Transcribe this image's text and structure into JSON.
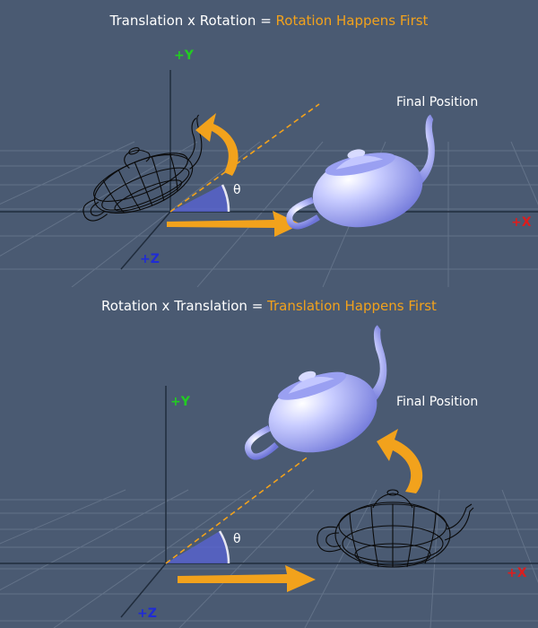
{
  "panels": [
    {
      "title_prefix": "Translation x Rotation = ",
      "title_highlight": "Rotation Happens First",
      "final_label": "Final Position",
      "theta": "θ",
      "axes": {
        "y": "+Y",
        "x": "+X",
        "z": "+Z"
      }
    },
    {
      "title_prefix": "Rotation x Translation = ",
      "title_highlight": "Translation Happens First",
      "final_label": "Final Position",
      "theta": "θ",
      "axes": {
        "y": "+Y",
        "x": "+X",
        "z": "+Z"
      }
    }
  ],
  "colors": {
    "background": "#4a5a72",
    "arrow": "#f2a21c",
    "teapot_solid": "#a9aef8",
    "angle_fill": "#5a64d8",
    "y_axis": "#22cc22",
    "x_axis": "#dd1d1d",
    "z_axis": "#1f2bd6"
  }
}
